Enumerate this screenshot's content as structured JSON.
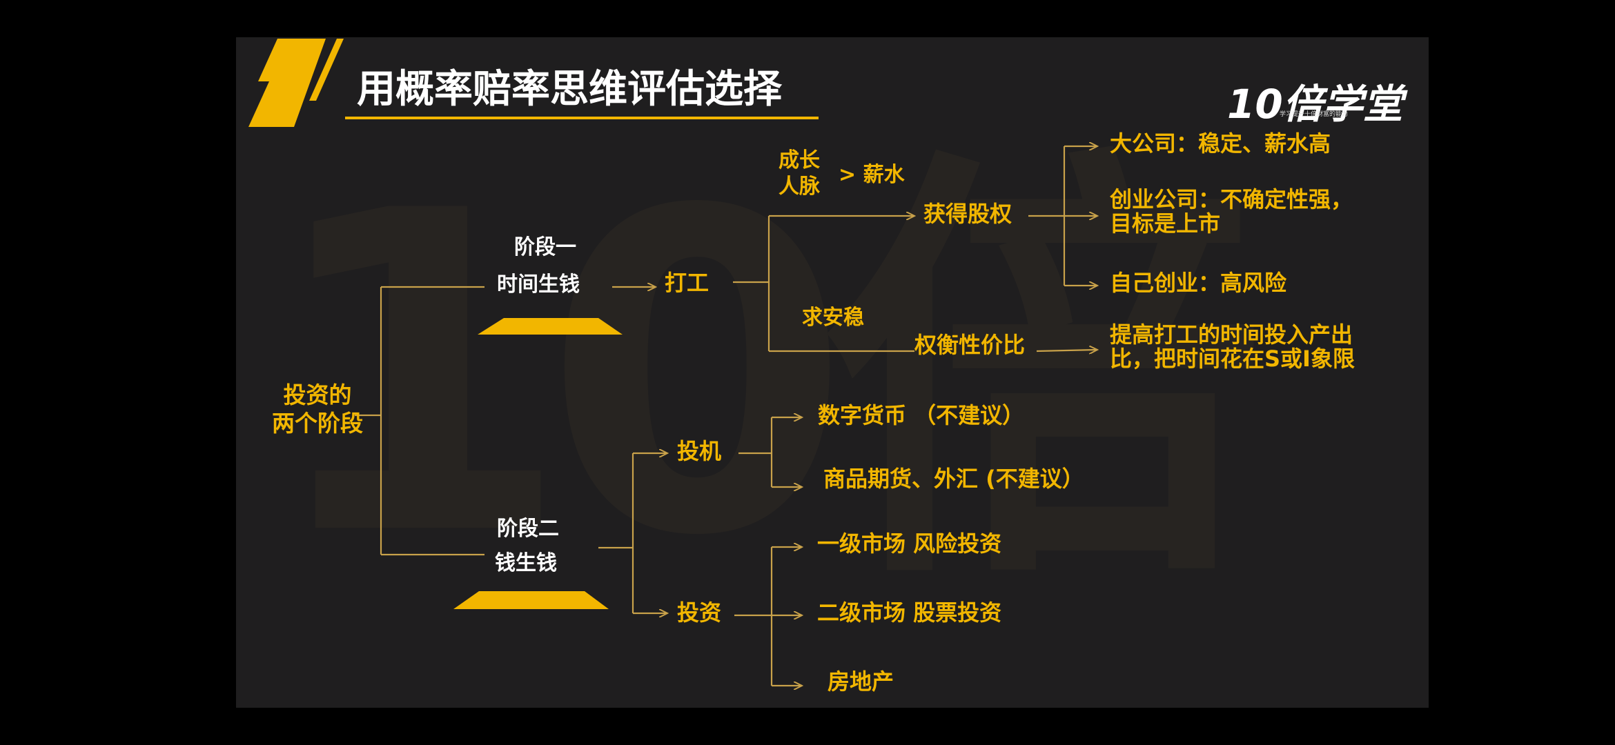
{
  "title": "用概率赔率思维评估选择",
  "logo": {
    "text": "10倍学堂",
    "tagline": "学习提升十倍财富的能力"
  },
  "watermark": "10倍",
  "root": {
    "line1": "投资的",
    "line2": "两个阶段"
  },
  "stage1": {
    "name": "阶段一",
    "desc": "时间生钱",
    "child": "打工",
    "growth": {
      "line1": "成长",
      "line2": "人脉",
      "compare": "> 薪水"
    },
    "equity": "获得股权",
    "stable": "求安稳",
    "tradeoff": "权衡性价比",
    "outcomes": {
      "big": "大公司：稳定、薪水高",
      "startup_l1": "创业公司：不确定性强，",
      "startup_l2": "目标是上市",
      "self": "自己创业：高风险",
      "improve_l1": "提高打工的时间投入产出",
      "improve_l2": "比，把时间花在S或I象限"
    }
  },
  "stage2": {
    "name": "阶段二",
    "desc": "钱生钱",
    "speculation": "投机",
    "investment": "投资",
    "spec_items": [
      "数字货币 （不建议）",
      "商品期货、外汇 (不建议）"
    ],
    "invest_items": [
      "一级市场 风险投资",
      "二级市场 股票投资",
      "房地产"
    ]
  },
  "colors": {
    "accent": "#f2b600",
    "background": "#1f1e1f",
    "line": "#c9a24a"
  }
}
